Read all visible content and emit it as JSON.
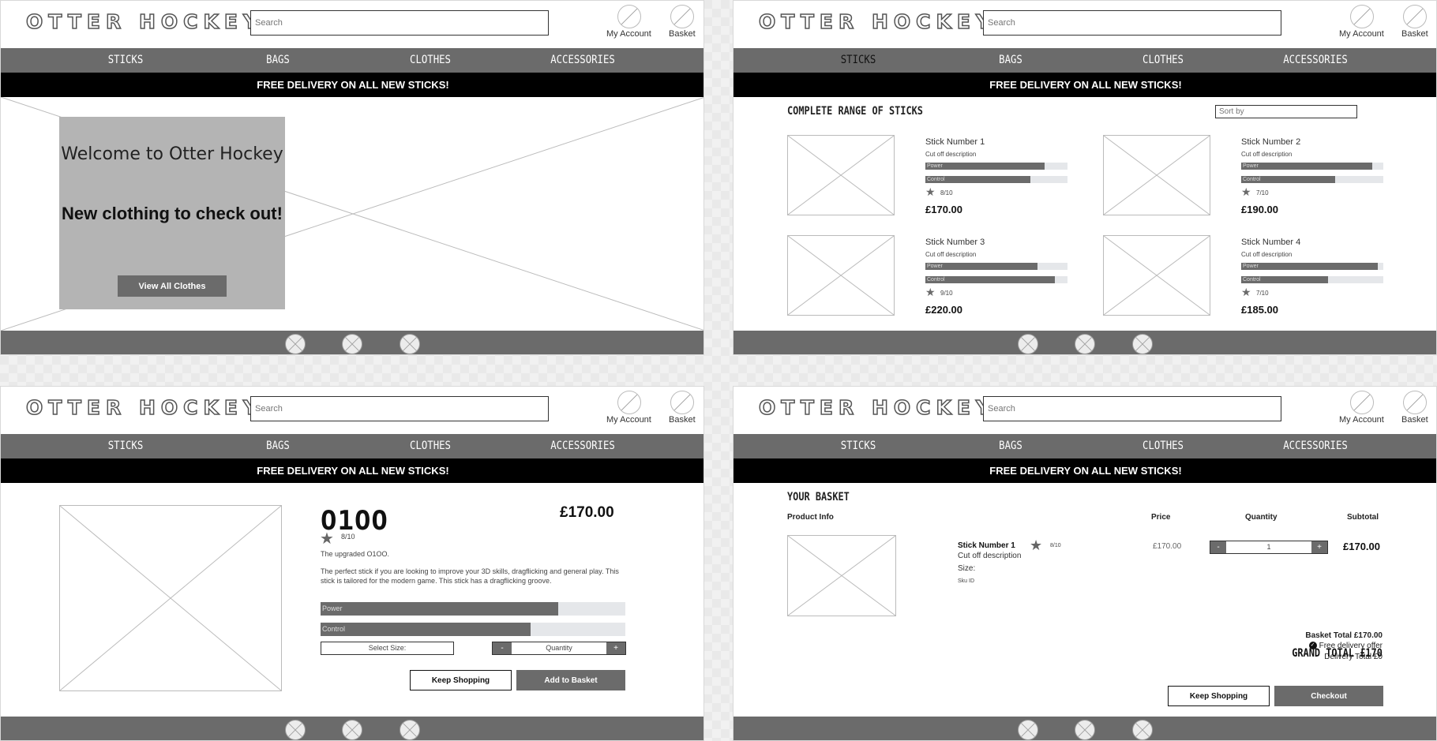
{
  "header": {
    "logo": "OTTER HOCKEY",
    "search_placeholder": "Search",
    "my_account": "My Account",
    "basket": "Basket"
  },
  "nav": [
    "STICKS",
    "BAGS",
    "CLOTHES",
    "ACCESSORIES"
  ],
  "promo": "FREE DELIVERY ON ALL NEW STICKS!",
  "home": {
    "welcome": "Welcome to Otter Hockey",
    "subtitle": "New clothing to check out!",
    "button": "View All Clothes"
  },
  "sticks": {
    "title": "COMPLETE RANGE OF STICKS",
    "sort_placeholder": "Sort by",
    "power_label": "Power",
    "control_label": "Control",
    "products": [
      {
        "name": "Stick Number 1",
        "desc": "Cut off description",
        "power": 0.84,
        "control": 0.74,
        "rating": "8/10",
        "price": "£170.00"
      },
      {
        "name": "Stick Number 2",
        "desc": "Cut off description",
        "power": 0.92,
        "control": 0.66,
        "rating": "7/10",
        "price": "£190.00"
      },
      {
        "name": "Stick Number 3",
        "desc": "Cut off description",
        "power": 0.79,
        "control": 0.91,
        "rating": "9/10",
        "price": "£220.00"
      },
      {
        "name": "Stick Number 4",
        "desc": "Cut off description",
        "power": 0.96,
        "control": 0.61,
        "rating": "7/10",
        "price": "£185.00"
      }
    ]
  },
  "product": {
    "logo": "O1OO",
    "price": "£170.00",
    "rating": "8/10",
    "subtitle": "The upgraded O1OO.",
    "description": "The perfect stick if you are looking to improve your 3D skills, dragflicking and general play. This stick is tailored for the modern game. This stick has a dragflicking groove.",
    "power_label": "Power",
    "power": 0.78,
    "control_label": "Control",
    "control": 0.69,
    "select_size": "Select Size:",
    "qty_minus": "-",
    "qty_label": "Quantity",
    "qty_plus": "+",
    "keep_shopping": "Keep Shopping",
    "add_to_basket": "Add to Basket"
  },
  "basket": {
    "title": "YOUR BASKET",
    "col_product": "Product Info",
    "col_price": "Price",
    "col_quantity": "Quantity",
    "col_subtotal": "Subtotal",
    "item": {
      "name": "Stick Number 1",
      "rating": "8/10",
      "desc": "Cut off description",
      "size": "Size:",
      "sku": "Sku ID",
      "price": "£170.00",
      "qty_minus": "-",
      "qty": "1",
      "qty_plus": "+",
      "subtotal": "£170.00"
    },
    "basket_total": "Basket Total £170.00",
    "free_delivery": "Free delivery offer",
    "delivery_total": "Delivery Total £0",
    "grand_total": "GRAND TOTAL £170",
    "keep_shopping": "Keep Shopping",
    "checkout": "Checkout"
  }
}
